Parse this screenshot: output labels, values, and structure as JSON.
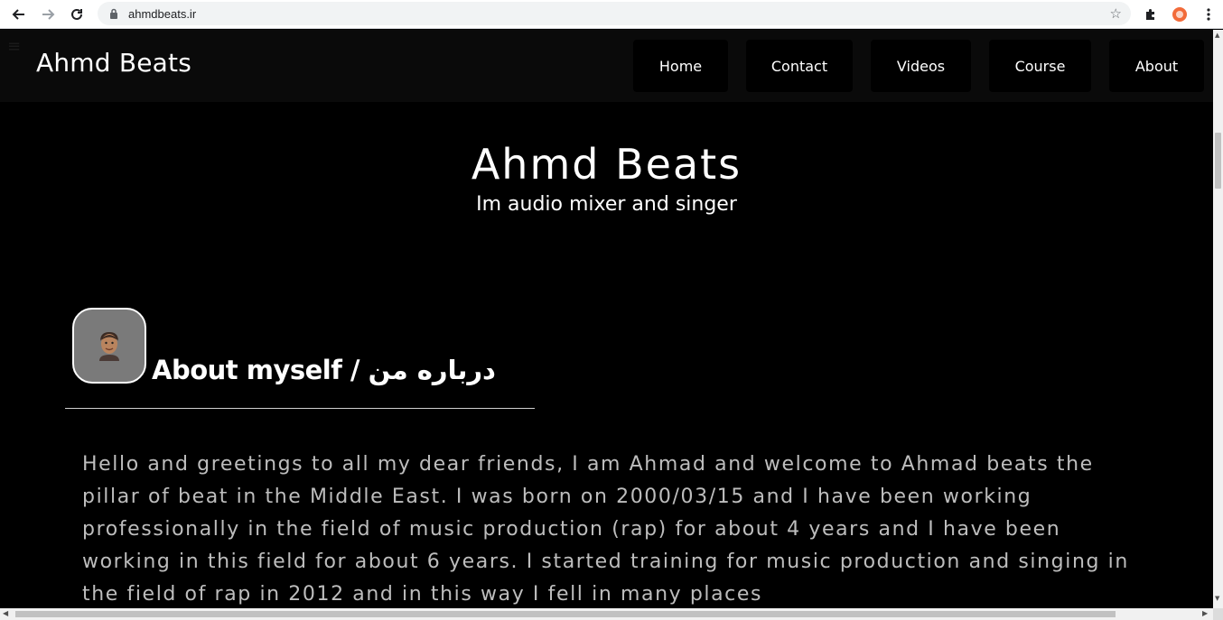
{
  "browser": {
    "url": "ahmdbeats.ir"
  },
  "site": {
    "brand": "Ahmd Beats",
    "nav": [
      "Home",
      "Contact",
      "Videos",
      "Course",
      "About"
    ]
  },
  "hero": {
    "title": "Ahmd Beats",
    "subtitle": "Im audio mixer and singer"
  },
  "about": {
    "heading": "About myself / درباره من",
    "avatar_emoji": "👨🏽",
    "bio": "Hello and greetings to all my dear friends, I am Ahmad and welcome to Ahmad beats the pillar of beat in the Middle East. I was born on 2000/03/15 and I have been working professionally in the field of music production (rap) for about 4 years and I have been working in this field for about 6 years. I started training for music production and singing in the field of rap in 2012 and in this way I fell in many places"
  },
  "colors": {
    "page_bg": "#000000",
    "topbar_bg": "#0a0a0a",
    "bio_text": "#bdbdbd",
    "avatar_bg": "#7a7a7a"
  }
}
